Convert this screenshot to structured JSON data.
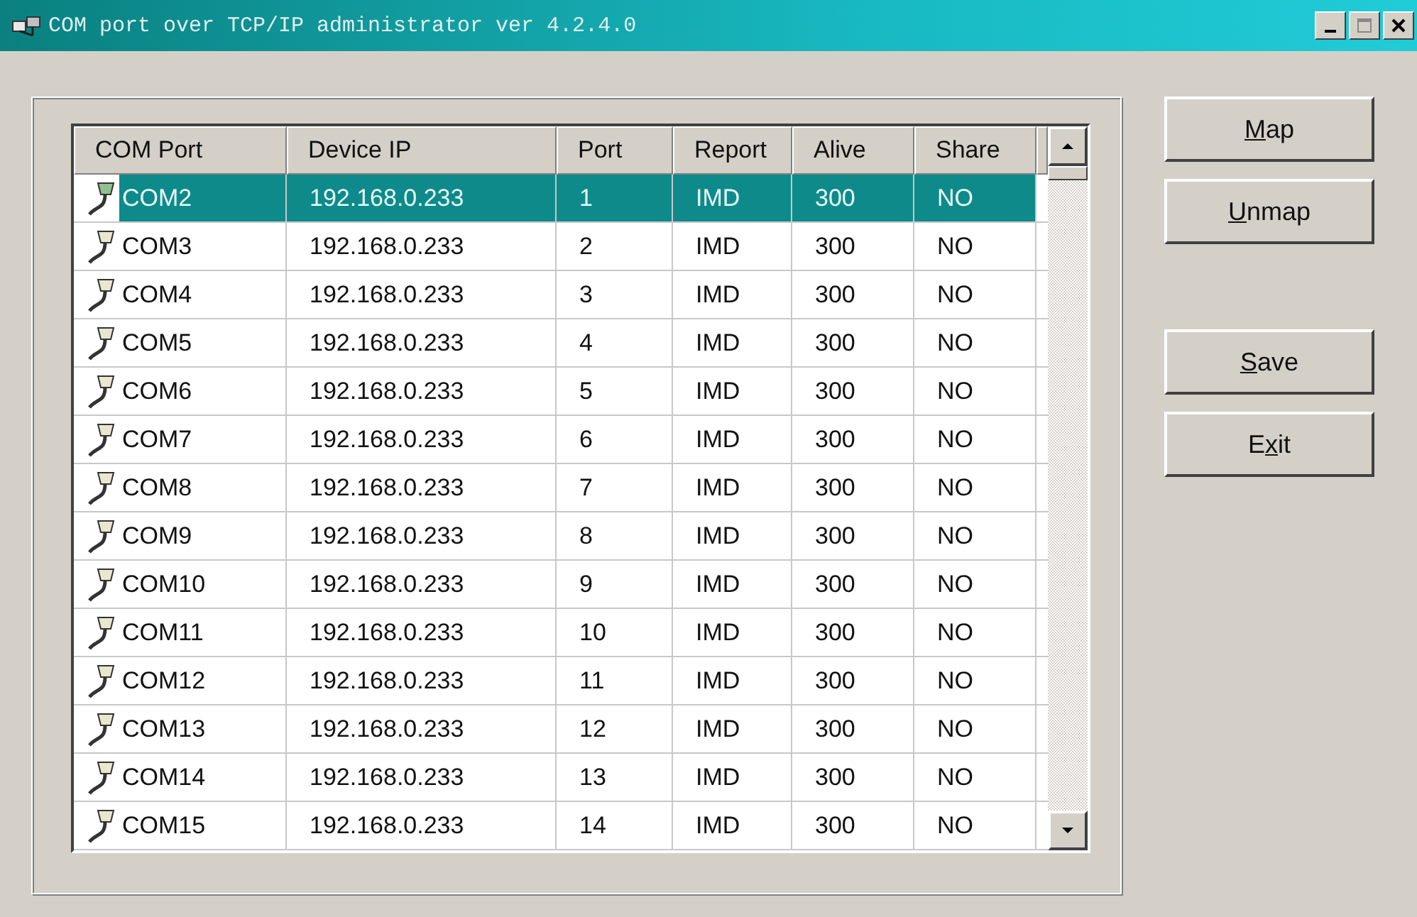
{
  "window": {
    "title": "COM port over TCP/IP administrator ver 4.2.4.0"
  },
  "table": {
    "columns": [
      "COM Port",
      "Device IP",
      "Port",
      "Report",
      "Alive",
      "Share"
    ],
    "rows": [
      {
        "cells": [
          "COM2",
          "192.168.0.233",
          "1",
          "IMD",
          "300",
          "NO"
        ],
        "selected": true
      },
      {
        "cells": [
          "COM3",
          "192.168.0.233",
          "2",
          "IMD",
          "300",
          "NO"
        ],
        "selected": false
      },
      {
        "cells": [
          "COM4",
          "192.168.0.233",
          "3",
          "IMD",
          "300",
          "NO"
        ],
        "selected": false
      },
      {
        "cells": [
          "COM5",
          "192.168.0.233",
          "4",
          "IMD",
          "300",
          "NO"
        ],
        "selected": false
      },
      {
        "cells": [
          "COM6",
          "192.168.0.233",
          "5",
          "IMD",
          "300",
          "NO"
        ],
        "selected": false
      },
      {
        "cells": [
          "COM7",
          "192.168.0.233",
          "6",
          "IMD",
          "300",
          "NO"
        ],
        "selected": false
      },
      {
        "cells": [
          "COM8",
          "192.168.0.233",
          "7",
          "IMD",
          "300",
          "NO"
        ],
        "selected": false
      },
      {
        "cells": [
          "COM9",
          "192.168.0.233",
          "8",
          "IMD",
          "300",
          "NO"
        ],
        "selected": false
      },
      {
        "cells": [
          "COM10",
          "192.168.0.233",
          "9",
          "IMD",
          "300",
          "NO"
        ],
        "selected": false
      },
      {
        "cells": [
          "COM11",
          "192.168.0.233",
          "10",
          "IMD",
          "300",
          "NO"
        ],
        "selected": false
      },
      {
        "cells": [
          "COM12",
          "192.168.0.233",
          "11",
          "IMD",
          "300",
          "NO"
        ],
        "selected": false
      },
      {
        "cells": [
          "COM13",
          "192.168.0.233",
          "12",
          "IMD",
          "300",
          "NO"
        ],
        "selected": false
      },
      {
        "cells": [
          "COM14",
          "192.168.0.233",
          "13",
          "IMD",
          "300",
          "NO"
        ],
        "selected": false
      },
      {
        "cells": [
          "COM15",
          "192.168.0.233",
          "14",
          "IMD",
          "300",
          "NO"
        ],
        "selected": false
      }
    ]
  },
  "buttons": [
    {
      "key": "M",
      "post": "ap",
      "kind": "gap_after_none"
    },
    {
      "key": "U",
      "post": "nmap",
      "kind": "gap_after"
    },
    {
      "key": "S",
      "post": "ave",
      "kind": "gap_after_none"
    },
    {
      "pre": "E",
      "key": "x",
      "post": "it",
      "kind": "gap_after_none"
    }
  ]
}
